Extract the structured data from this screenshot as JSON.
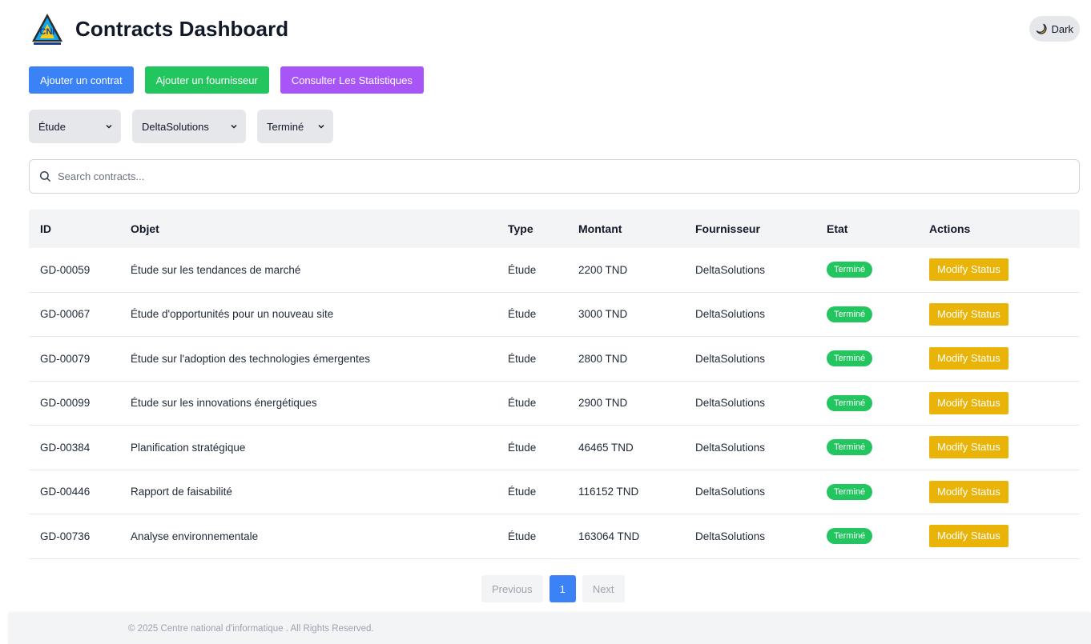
{
  "header": {
    "title": "Contracts Dashboard",
    "logo_text": "CNI"
  },
  "theme_toggle": {
    "label": "Dark",
    "icon": "moon-icon"
  },
  "actions": {
    "add_contract": "Ajouter un contrat",
    "add_supplier": "Ajouter un fournisseur",
    "statistics": "Consulter Les Statistiques"
  },
  "filters": {
    "type": "Étude",
    "supplier": "DeltaSolutions",
    "status": "Terminé"
  },
  "search": {
    "placeholder": "Search contracts...",
    "value": ""
  },
  "table": {
    "headers": [
      "ID",
      "Objet",
      "Type",
      "Montant",
      "Fournisseur",
      "Etat",
      "Actions"
    ],
    "action_label": "Modify Status",
    "rows": [
      [
        "GD-00059",
        "Étude sur les tendances de marché",
        "Étude",
        "2200 TND",
        "DeltaSolutions",
        "Terminé"
      ],
      [
        "GD-00067",
        "Étude d'opportunités pour un nouveau site",
        "Étude",
        "3000 TND",
        "DeltaSolutions",
        "Terminé"
      ],
      [
        "GD-00079",
        "Étude sur l'adoption des technologies émergentes",
        "Étude",
        "2800 TND",
        "DeltaSolutions",
        "Terminé"
      ],
      [
        "GD-00099",
        "Étude sur les innovations énergétiques",
        "Étude",
        "2900 TND",
        "DeltaSolutions",
        "Terminé"
      ],
      [
        "GD-00384",
        "Planification stratégique",
        "Étude",
        "46465 TND",
        "DeltaSolutions",
        "Terminé"
      ],
      [
        "GD-00446",
        "Rapport de faisabilité",
        "Étude",
        "116152 TND",
        "DeltaSolutions",
        "Terminé"
      ],
      [
        "GD-00736",
        "Analyse environnementale",
        "Étude",
        "163064 TND",
        "DeltaSolutions",
        "Terminé"
      ]
    ]
  },
  "pagination": {
    "previous": "Previous",
    "current": "1",
    "next": "Next"
  },
  "footer": {
    "text": "© 2025 Centre national d'informatique . All Rights Reserved."
  },
  "colors": {
    "primary": "#3b82f6",
    "success": "#22c55e",
    "purple": "#a855f7",
    "warning": "#eab308"
  }
}
